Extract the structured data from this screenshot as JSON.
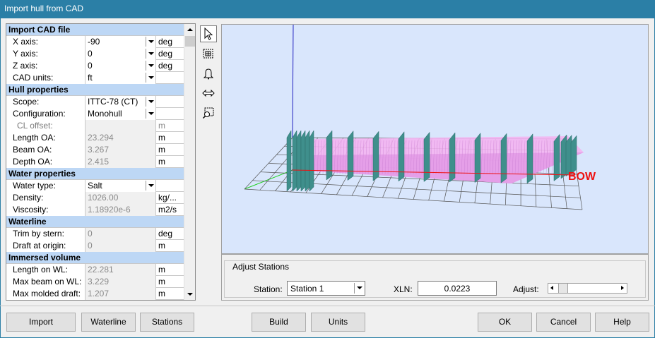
{
  "window": {
    "title": "Import hull from CAD"
  },
  "grid": {
    "sections": [
      {
        "title": "Import CAD file",
        "rows": [
          {
            "label": "X axis:",
            "value": "-90",
            "unit": "deg",
            "kind": "combo"
          },
          {
            "label": "Y axis:",
            "value": "0",
            "unit": "deg",
            "kind": "combo"
          },
          {
            "label": "Z axis:",
            "value": "0",
            "unit": "deg",
            "kind": "combo"
          },
          {
            "label": "CAD units:",
            "value": "ft",
            "unit": "",
            "kind": "combo"
          }
        ]
      },
      {
        "title": "Hull properties",
        "rows": [
          {
            "label": "Scope:",
            "value": "ITTC-78 (CT)",
            "unit": "",
            "kind": "combo"
          },
          {
            "label": "Configuration:",
            "value": "Monohull",
            "unit": "",
            "kind": "combo"
          },
          {
            "label": "CL offset:",
            "value": "",
            "unit": "m",
            "kind": "disabled"
          },
          {
            "label": "Length OA:",
            "value": "23.294",
            "unit": "m",
            "kind": "readonly"
          },
          {
            "label": "Beam OA:",
            "value": "3.267",
            "unit": "m",
            "kind": "readonly"
          },
          {
            "label": "Depth OA:",
            "value": "2.415",
            "unit": "m",
            "kind": "readonly"
          }
        ]
      },
      {
        "title": "Water properties",
        "rows": [
          {
            "label": "Water type:",
            "value": "Salt",
            "unit": "",
            "kind": "combo"
          },
          {
            "label": "Density:",
            "value": "1026.00",
            "unit": "kg/...",
            "kind": "readonly"
          },
          {
            "label": "Viscosity:",
            "value": "1.18920e-6",
            "unit": "m2/s",
            "kind": "readonly"
          }
        ]
      },
      {
        "title": "Waterline",
        "rows": [
          {
            "label": "Trim by stern:",
            "value": "0",
            "unit": "deg",
            "kind": "readonly"
          },
          {
            "label": "Draft at origin:",
            "value": "0",
            "unit": "m",
            "kind": "readonly"
          }
        ]
      },
      {
        "title": "Immersed volume",
        "rows": [
          {
            "label": "Length on WL:",
            "value": "22.281",
            "unit": "m",
            "kind": "readonly"
          },
          {
            "label": "Max beam on WL:",
            "value": "3.229",
            "unit": "m",
            "kind": "readonly"
          },
          {
            "label": "Max molded draft:",
            "value": "1.207",
            "unit": "m",
            "kind": "readonly"
          }
        ]
      }
    ]
  },
  "toolbar": [
    "pointer-icon",
    "select-stations-icon",
    "bell-icon",
    "horizontal-arrows-icon",
    "zoom-region-icon"
  ],
  "view": {
    "bow_label": "BOW"
  },
  "adjust": {
    "legend": "Adjust Stations",
    "station_label": "Station:",
    "station_value": "Station 1",
    "xln_label": "XLN:",
    "xln_value": "0.0223",
    "adjust_label": "Adjust:"
  },
  "buttons": {
    "import": "Import",
    "waterline": "Waterline",
    "stations": "Stations",
    "build": "Build",
    "units": "Units",
    "ok": "OK",
    "cancel": "Cancel",
    "help": "Help"
  },
  "colors": {
    "title_bar": "#2b7fa6",
    "section_header": "#bdd7f5",
    "view_bg": "#d9e6fc",
    "hull_pink": "#f0a8ee",
    "station_teal": "#3a8a8a",
    "bow_red": "#e11111"
  }
}
